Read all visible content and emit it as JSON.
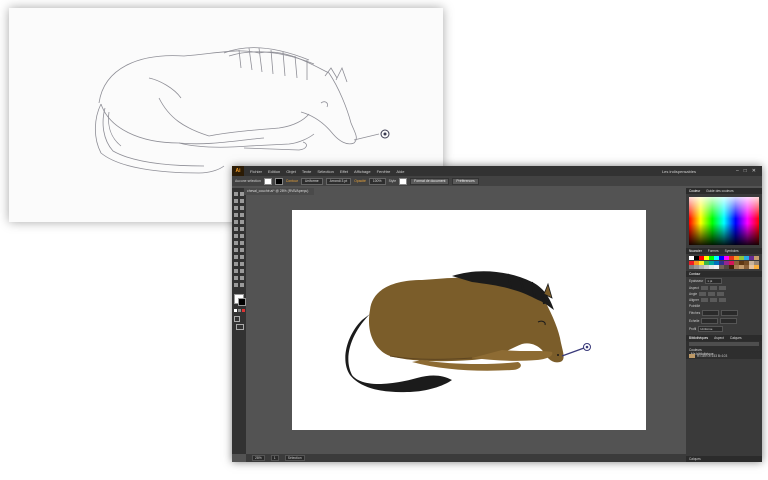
{
  "menubar": {
    "logo": "Ai",
    "items": [
      "Fichier",
      "Edition",
      "Objet",
      "Texte",
      "Sélection",
      "Effet",
      "Affichage",
      "Fenêtre",
      "Aide"
    ],
    "workspace": "Les indispensables"
  },
  "control_bar": {
    "selection_label": "Aucune sélection",
    "contour_label": "Contour",
    "stroke_style": "Uniforme",
    "stroke_profile": "Arrondi 3 pt",
    "opacity_label": "Opacité",
    "opacity_value": "100%",
    "style_label": "Style",
    "doc_format_button": "Format de document",
    "prefs_button": "Préférences"
  },
  "document_tab": "cheval_couché.ai* @ 28% (RVB/Aperçu)",
  "colors": {
    "horse_body": "#7b5d2a",
    "horse_mane": "#1b1b1b",
    "app_dark": "#323232",
    "canvas_bg": "#535353"
  },
  "panels": {
    "tabs": [
      "Couleur",
      "Guide des couleurs"
    ],
    "swatch_tabs": [
      "Nuancier",
      "Formes",
      "Symboles"
    ],
    "properties_title": "Contour",
    "properties_rows": [
      {
        "label": "Epaisseur",
        "value": "1 pt"
      },
      {
        "label": "Aspect",
        "value": ""
      },
      {
        "label": "Angle",
        "value": ""
      },
      {
        "label": "Aligner",
        "value": ""
      }
    ],
    "dash_label": "Pointillé",
    "arrows_label": "Flèches",
    "scale_label": "Echelle",
    "profile_label": "Profil",
    "profile_value": "Uniforme",
    "libraries_tabs": [
      "Bibliothèques",
      "Aspect",
      "Calques"
    ],
    "library_title": "Ma bibliothèque",
    "library_subtitle": "Couleurs",
    "library_item": "R=189 G=153 B=103",
    "layers_label": "Calques"
  },
  "statusbar": {
    "zoom": "28%",
    "page": "1",
    "tool": "Sélection"
  }
}
